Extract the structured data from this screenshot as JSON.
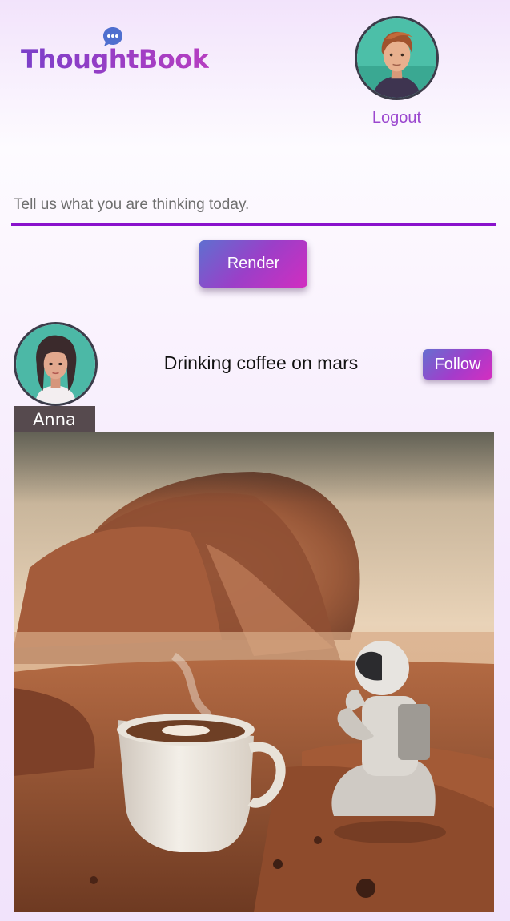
{
  "header": {
    "brand": "ThoughtBook",
    "logo_icon": "chat-bubble-icon",
    "brand_color": "#9b47cf",
    "logout_label": "Logout"
  },
  "composer": {
    "placeholder": "Tell us what you are thinking today.",
    "value": "",
    "render_label": "Render",
    "accent_color": "#8a12cc"
  },
  "feed": {
    "posts": [
      {
        "author": "Anna",
        "caption": "Drinking coffee on mars",
        "follow_label": "Follow",
        "image_alt": "astronaut-coffee-on-mars-image"
      }
    ]
  }
}
